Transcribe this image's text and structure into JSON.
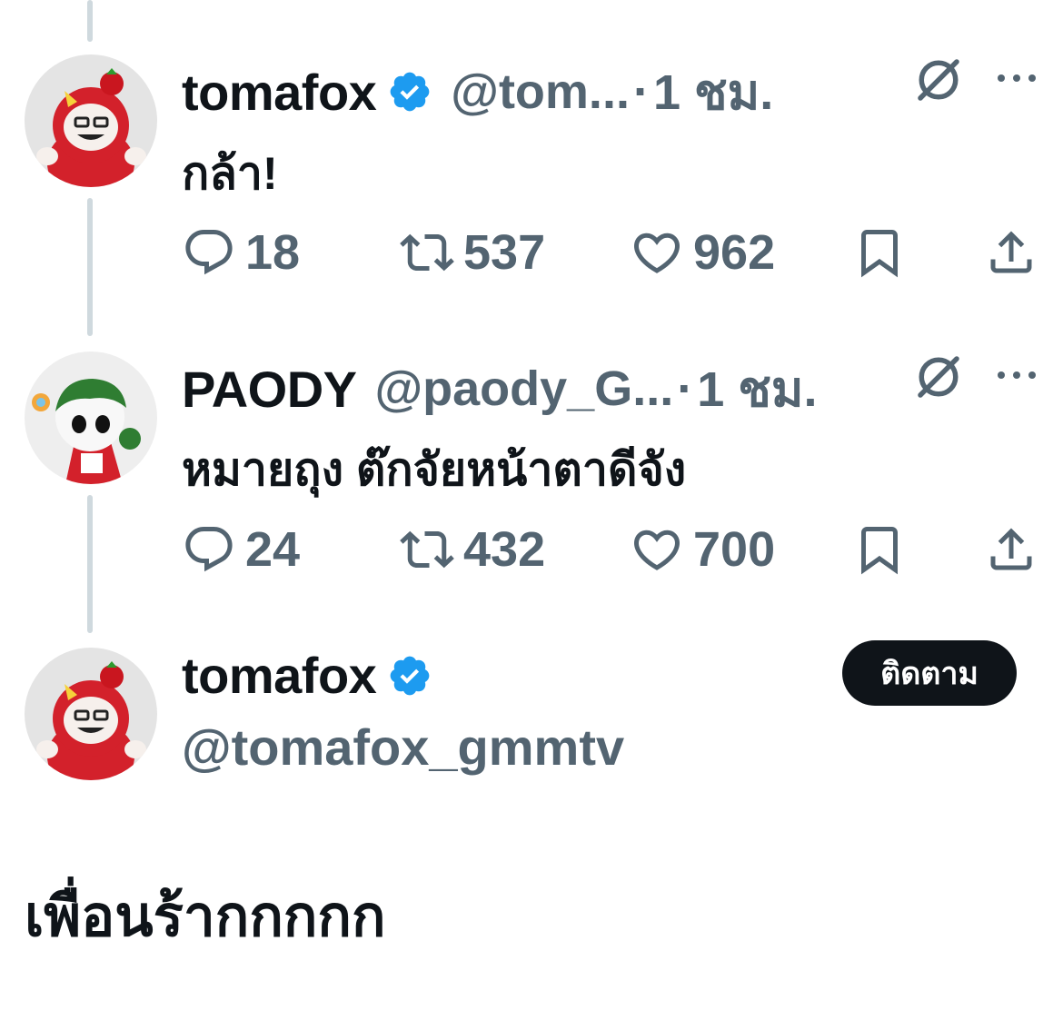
{
  "colors": {
    "text": "#0f1419",
    "secondary": "#536471",
    "verified": "#1d9bf0",
    "thread_line": "#cfd9de",
    "button_bg": "#0f1419"
  },
  "replies": [
    {
      "name": "tomafox",
      "verified": true,
      "handle": "@tom...",
      "dot": "·",
      "time": "1 ชม.",
      "text": "กล้า!",
      "counts": {
        "reply": "18",
        "retweet": "537",
        "like": "962"
      },
      "avatar_icon": "tomafox-avatar-icon"
    },
    {
      "name": "PAODY",
      "verified": false,
      "handle": "@paody_G...",
      "dot": "·",
      "time": "1 ชม.",
      "text": "หมายถุง ต๊กจัยหน้าตาดีจัง",
      "counts": {
        "reply": "24",
        "retweet": "432",
        "like": "700"
      },
      "avatar_icon": "paody-avatar-icon"
    }
  ],
  "main_post": {
    "name": "tomafox",
    "verified": true,
    "handle": "@tomafox_gmmtv",
    "follow_label": "ติดตาม",
    "text": "เพื่อนร้ากกกกก",
    "avatar_icon": "tomafox-avatar-icon"
  },
  "icons": [
    "reply-icon",
    "retweet-icon",
    "like-icon",
    "bookmark-icon",
    "share-icon",
    "grok-icon",
    "more-icon",
    "verified-badge-icon"
  ]
}
